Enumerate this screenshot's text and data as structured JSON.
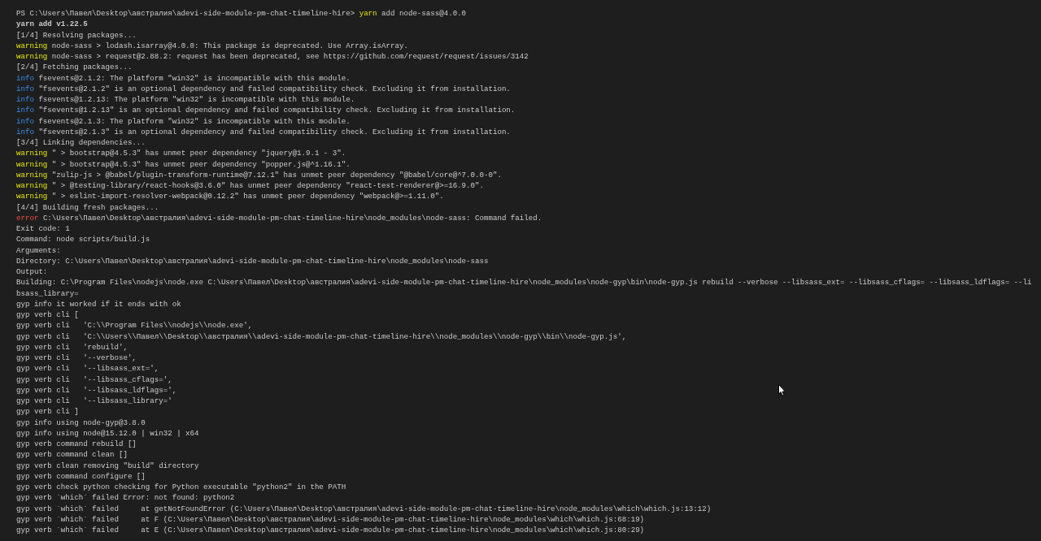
{
  "terminal": {
    "lines": [
      {
        "kind": "prompt",
        "prompt": "PS C:\\Users\\Павел\\Desktop\\австралия\\adevi-side-module-pm-chat-timeline-hire>",
        "label": "yarn",
        "text": "add node-sass@4.0.0"
      },
      {
        "kind": "bold",
        "text": "yarn add v1.22.5"
      },
      {
        "kind": "plain",
        "text": "[1/4] Resolving packages..."
      },
      {
        "kind": "warning",
        "label": "warning",
        "text": "node-sass > lodash.isarray@4.0.0: This package is deprecated. Use Array.isArray."
      },
      {
        "kind": "warning",
        "label": "warning",
        "text": "node-sass > request@2.88.2: request has been deprecated, see https://github.com/request/request/issues/3142"
      },
      {
        "kind": "plain",
        "text": "[2/4] Fetching packages..."
      },
      {
        "kind": "info",
        "label": "info",
        "text": "fsevents@2.1.2: The platform \"win32\" is incompatible with this module."
      },
      {
        "kind": "info",
        "label": "info",
        "text": "\"fsevents@2.1.2\" is an optional dependency and failed compatibility check. Excluding it from installation."
      },
      {
        "kind": "info",
        "label": "info",
        "text": "fsevents@1.2.13: The platform \"win32\" is incompatible with this module."
      },
      {
        "kind": "info",
        "label": "info",
        "text": "\"fsevents@1.2.13\" is an optional dependency and failed compatibility check. Excluding it from installation."
      },
      {
        "kind": "info",
        "label": "info",
        "text": "fsevents@2.1.3: The platform \"win32\" is incompatible with this module."
      },
      {
        "kind": "info",
        "label": "info",
        "text": "\"fsevents@2.1.3\" is an optional dependency and failed compatibility check. Excluding it from installation."
      },
      {
        "kind": "plain",
        "text": "[3/4] Linking dependencies..."
      },
      {
        "kind": "warning",
        "label": "warning",
        "text": "\" > bootstrap@4.5.3\" has unmet peer dependency \"jquery@1.9.1 - 3\"."
      },
      {
        "kind": "warning",
        "label": "warning",
        "text": "\" > bootstrap@4.5.3\" has unmet peer dependency \"popper.js@^1.16.1\"."
      },
      {
        "kind": "warning",
        "label": "warning",
        "text": "\"zulip-js > @babel/plugin-transform-runtime@7.12.1\" has unmet peer dependency \"@babel/core@^7.0.0-0\"."
      },
      {
        "kind": "warning",
        "label": "warning",
        "text": "\" > @testing-library/react-hooks@3.6.0\" has unmet peer dependency \"react-test-renderer@>=16.9.0\"."
      },
      {
        "kind": "warning",
        "label": "warning",
        "text": "\" > eslint-import-resolver-webpack@0.12.2\" has unmet peer dependency \"webpack@>=1.11.0\"."
      },
      {
        "kind": "plain",
        "text": "[4/4] Building fresh packages..."
      },
      {
        "kind": "error",
        "label": "error",
        "text": "C:\\Users\\Павел\\Desktop\\австралия\\adevi-side-module-pm-chat-timeline-hire\\node_modules\\node-sass: Command failed."
      },
      {
        "kind": "plain",
        "text": "Exit code: 1"
      },
      {
        "kind": "plain",
        "text": "Command: node scripts/build.js"
      },
      {
        "kind": "plain",
        "text": "Arguments:"
      },
      {
        "kind": "plain",
        "text": "Directory: C:\\Users\\Павел\\Desktop\\австралия\\adevi-side-module-pm-chat-timeline-hire\\node_modules\\node-sass"
      },
      {
        "kind": "plain",
        "text": "Output:"
      },
      {
        "kind": "plain",
        "text": "Building: C:\\Program Files\\nodejs\\node.exe C:\\Users\\Павел\\Desktop\\австралия\\adevi-side-module-pm-chat-timeline-hire\\node_modules\\node-gyp\\bin\\node-gyp.js rebuild --verbose --libsass_ext= --libsass_cflags= --libsass_ldflags= --li"
      },
      {
        "kind": "plain",
        "text": "bsass_library="
      },
      {
        "kind": "plain",
        "text": "gyp info it worked if it ends with ok"
      },
      {
        "kind": "plain",
        "text": "gyp verb cli ["
      },
      {
        "kind": "plain",
        "text": "gyp verb cli   'C:\\\\Program Files\\\\nodejs\\\\node.exe',"
      },
      {
        "kind": "plain",
        "text": "gyp verb cli   'C:\\\\Users\\\\Павел\\\\Desktop\\\\австралия\\\\adevi-side-module-pm-chat-timeline-hire\\\\node_modules\\\\node-gyp\\\\bin\\\\node-gyp.js',"
      },
      {
        "kind": "plain",
        "text": "gyp verb cli   'rebuild',"
      },
      {
        "kind": "plain",
        "text": "gyp verb cli   '--verbose',"
      },
      {
        "kind": "plain",
        "text": "gyp verb cli   '--libsass_ext=',"
      },
      {
        "kind": "plain",
        "text": "gyp verb cli   '--libsass_cflags=',"
      },
      {
        "kind": "plain",
        "text": "gyp verb cli   '--libsass_ldflags=',"
      },
      {
        "kind": "plain",
        "text": "gyp verb cli   '--libsass_library='"
      },
      {
        "kind": "plain",
        "text": "gyp verb cli ]"
      },
      {
        "kind": "plain",
        "text": "gyp info using node-gyp@3.8.0"
      },
      {
        "kind": "plain",
        "text": "gyp info using node@15.12.0 | win32 | x64"
      },
      {
        "kind": "plain",
        "text": "gyp verb command rebuild []"
      },
      {
        "kind": "plain",
        "text": "gyp verb command clean []"
      },
      {
        "kind": "plain",
        "text": "gyp verb clean removing \"build\" directory"
      },
      {
        "kind": "plain",
        "text": "gyp verb command configure []"
      },
      {
        "kind": "plain",
        "text": "gyp verb check python checking for Python executable \"python2\" in the PATH"
      },
      {
        "kind": "plain",
        "text": "gyp verb `which` failed Error: not found: python2"
      },
      {
        "kind": "plain",
        "text": "gyp verb `which` failed     at getNotFoundError (C:\\Users\\Павел\\Desktop\\австралия\\adevi-side-module-pm-chat-timeline-hire\\node_modules\\which\\which.js:13:12)"
      },
      {
        "kind": "plain",
        "text": "gyp verb `which` failed     at F (C:\\Users\\Павел\\Desktop\\австралия\\adevi-side-module-pm-chat-timeline-hire\\node_modules\\which\\which.js:68:19)"
      },
      {
        "kind": "plain",
        "text": "gyp verb `which` failed     at E (C:\\Users\\Павел\\Desktop\\австралия\\adevi-side-module-pm-chat-timeline-hire\\node_modules\\which\\which.js:80:29)"
      }
    ]
  }
}
